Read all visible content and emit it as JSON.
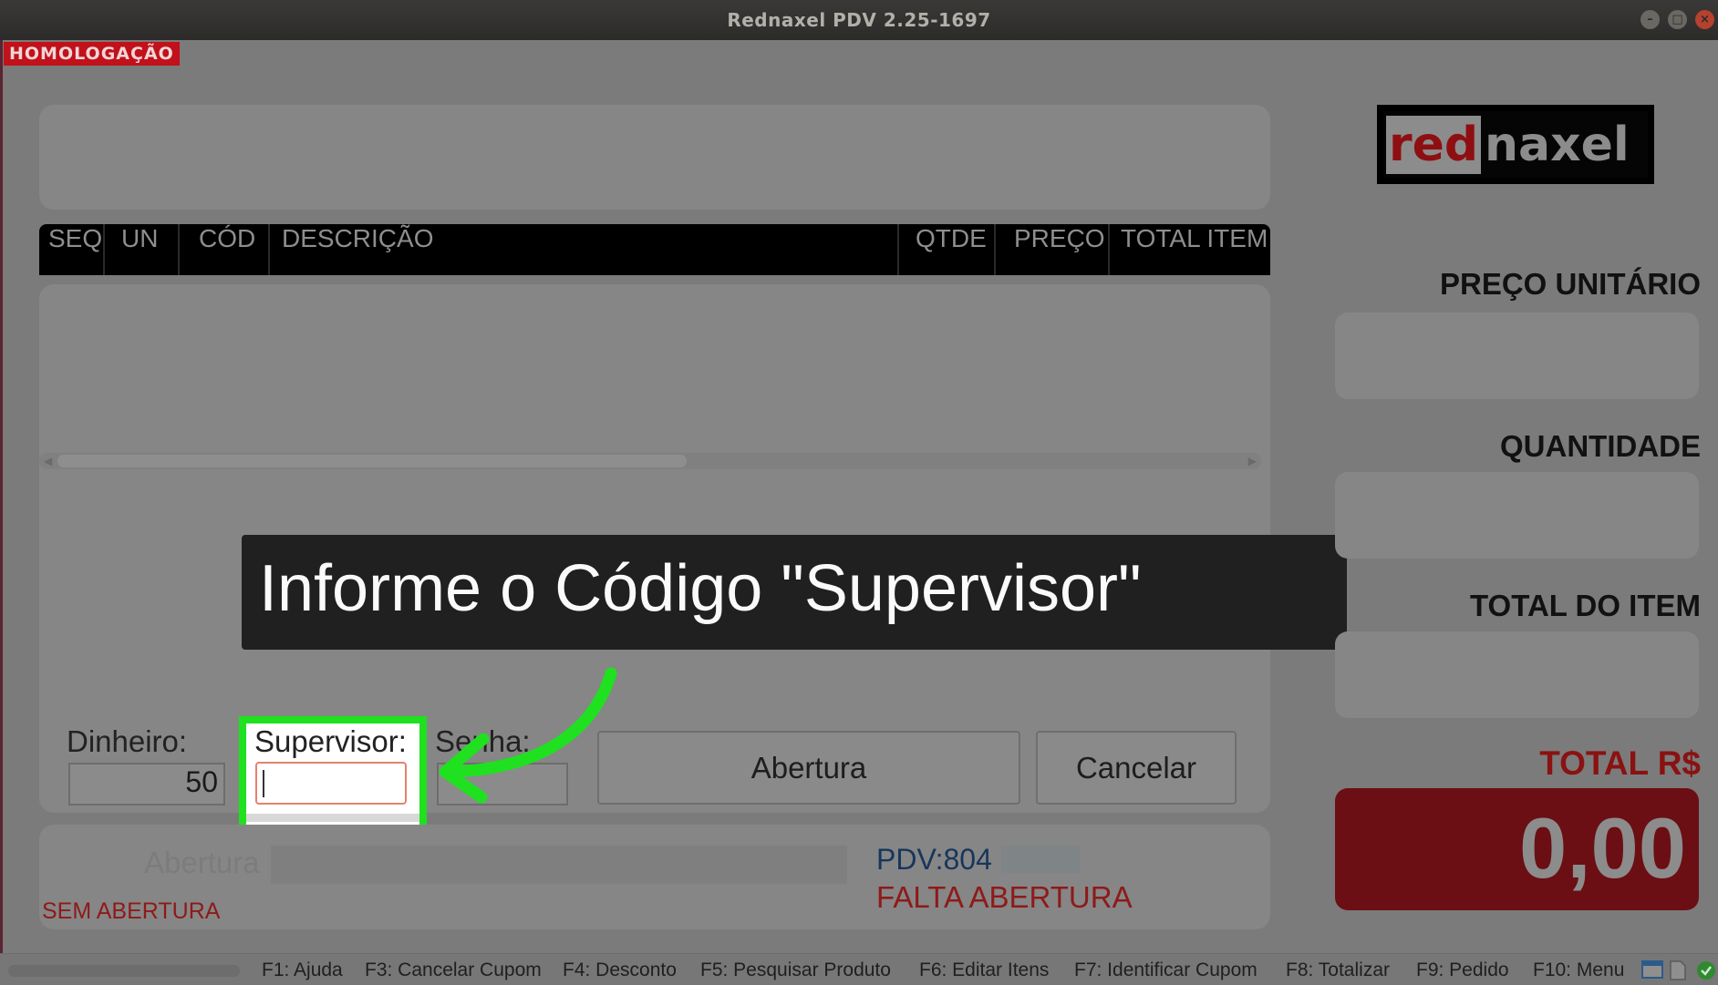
{
  "window": {
    "title": "Rednaxel PDV 2.25-1697"
  },
  "environment_badge": "HOMOLOGAÇÃO",
  "table": {
    "columns": [
      "SEQ",
      "UN",
      "CÓD",
      "DESCRIÇÃO",
      "QTDE",
      "PREÇO",
      "TOTAL ITEM"
    ]
  },
  "logo": {
    "red_part": "red",
    "white_part": "naxel"
  },
  "side_panel": {
    "unit_price_label": "PREÇO UNITÁRIO",
    "quantity_label": "QUANTIDADE",
    "item_total_label": "TOTAL DO ITEM",
    "total_label": "TOTAL R$",
    "total_value": "0,00"
  },
  "opening_form": {
    "cash_label": "Dinheiro:",
    "cash_value": "50",
    "supervisor_label": "Supervisor:",
    "supervisor_value": "",
    "password_label": "Senha:",
    "open_button": "Abertura",
    "cancel_button": "Cancelar"
  },
  "callout": {
    "text": "Informe o Código \"Supervisor\""
  },
  "status_area": {
    "opening_label": "Abertura",
    "opening_state": "SEM ABERTURA",
    "pdv": "PDV:804",
    "pending": "FALTA ABERTURA"
  },
  "shortcuts": [
    "F1: Ajuda",
    "F3: Cancelar Cupom",
    "F4: Desconto",
    "F5: Pesquisar Produto",
    "F6: Editar Itens",
    "F7: Identificar Cupom",
    "F8: Totalizar",
    "F9: Pedido",
    "F10: Menu"
  ],
  "colors": {
    "highlight": "#1fe11f",
    "total_background": "#6b0f14",
    "badge": "#c1111a"
  }
}
